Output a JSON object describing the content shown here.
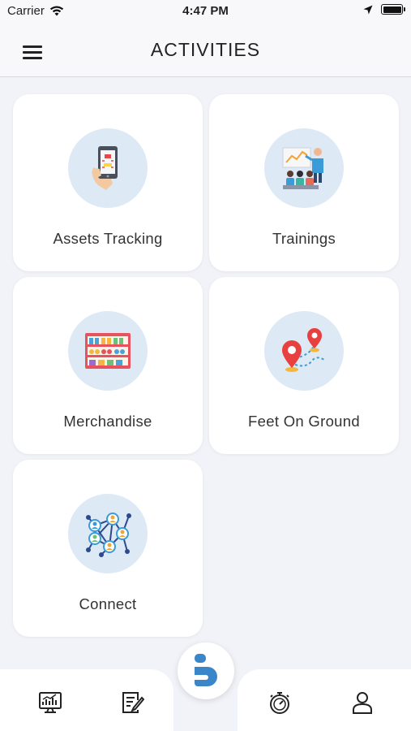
{
  "status_bar": {
    "carrier": "Carrier",
    "time": "4:47 PM"
  },
  "header": {
    "title": "ACTIVITIES",
    "menu_icon": "hamburger-menu-icon"
  },
  "activities": [
    {
      "label": "Assets Tracking",
      "icon": "phone-scan-icon"
    },
    {
      "label": "Trainings",
      "icon": "presentation-icon"
    },
    {
      "label": "Merchandise",
      "icon": "store-shelf-icon"
    },
    {
      "label": "Feet On Ground",
      "icon": "map-route-icon"
    },
    {
      "label": "Connect",
      "icon": "network-people-icon"
    }
  ],
  "bottom_nav": {
    "items": [
      "dashboard-monitor-icon",
      "notes-edit-icon",
      "brand-logo-icon",
      "stopwatch-icon",
      "profile-icon"
    ]
  },
  "colors": {
    "accent": "#3a86c8",
    "circle_bg": "#dde9f5",
    "page_bg": "#f2f3f8"
  }
}
